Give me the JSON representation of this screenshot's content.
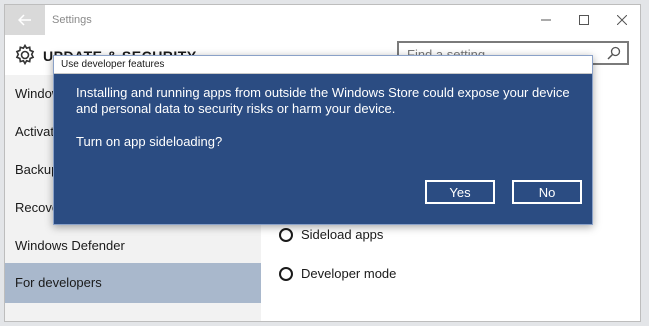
{
  "window": {
    "app_title": "Settings",
    "back_icon": "back-arrow-icon",
    "controls": [
      "minimize-icon",
      "maximize-icon",
      "close-icon"
    ]
  },
  "header": {
    "title": "UPDATE & SECURITY",
    "icon": "gear-icon",
    "search_placeholder": "Find a setting"
  },
  "sidebar": {
    "items": [
      {
        "label": "Windows Update",
        "selected": false
      },
      {
        "label": "Activation",
        "selected": false
      },
      {
        "label": "Backup",
        "selected": false
      },
      {
        "label": "Recovery",
        "selected": false
      },
      {
        "label": "Windows Defender",
        "selected": false
      },
      {
        "label": "For developers",
        "selected": true
      }
    ]
  },
  "content": {
    "options": [
      {
        "label": "Sideload apps",
        "checked": false
      },
      {
        "label": "Developer mode",
        "checked": false
      }
    ]
  },
  "dialog": {
    "title": "Use developer features",
    "message": "Installing and running apps from outside the Windows Store could expose your device and personal data to security risks or harm your device.",
    "question": "Turn on app sideloading?",
    "yes_label": "Yes",
    "no_label": "No"
  },
  "colors": {
    "dialog_bg": "#2b4c82",
    "sidebar_selected": "#a9b8cc"
  }
}
